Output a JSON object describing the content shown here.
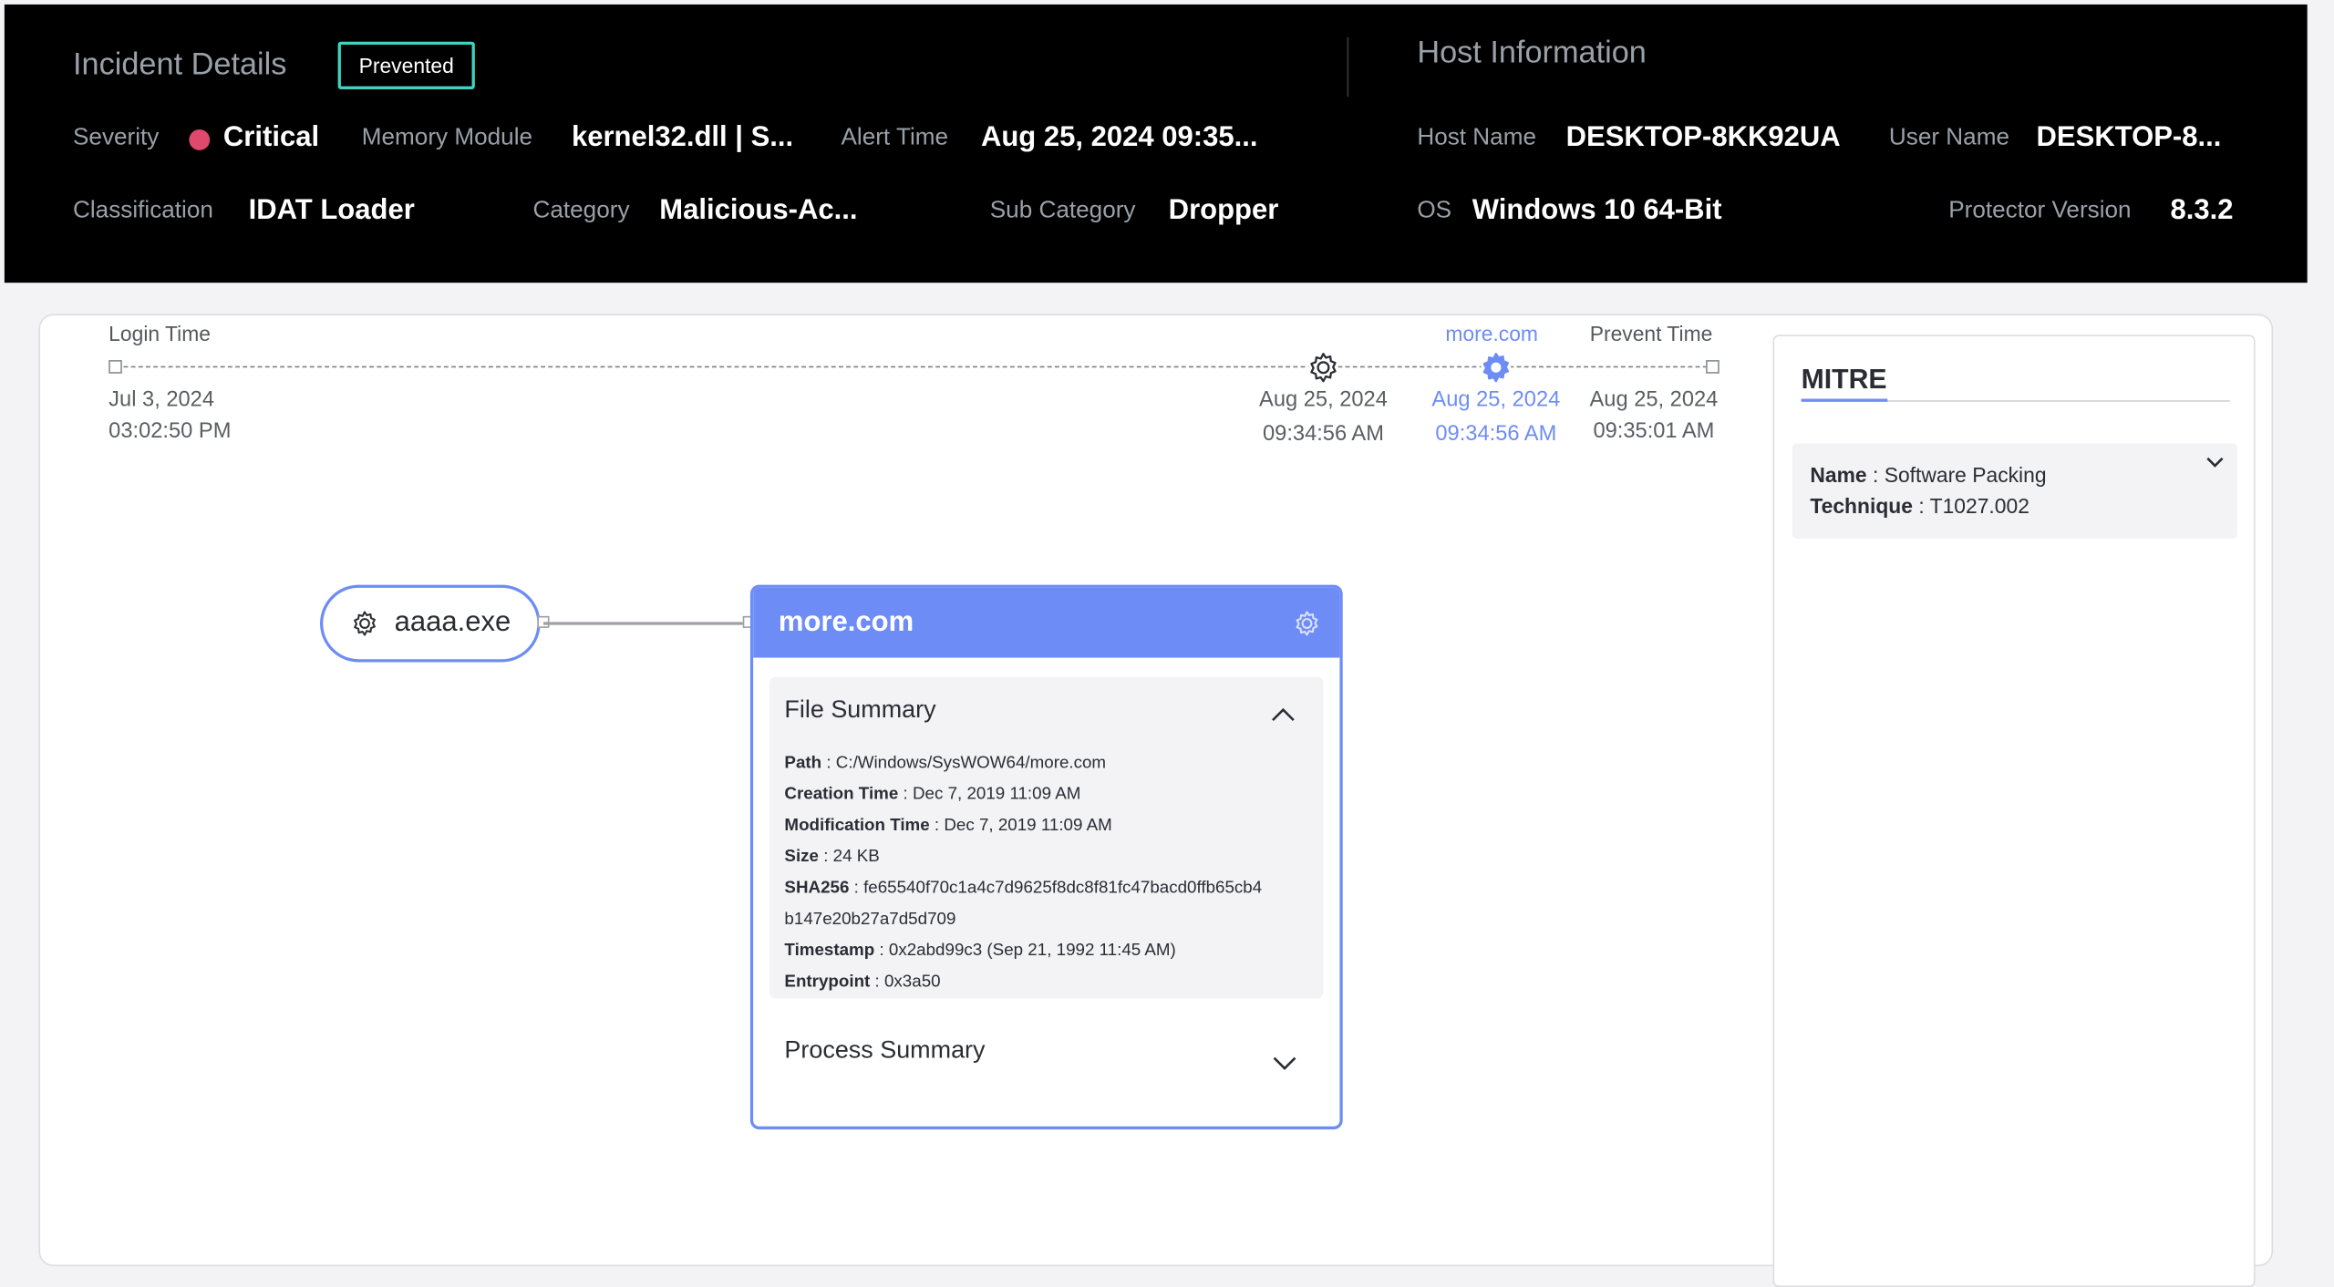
{
  "incident": {
    "title": "Incident Details",
    "status_badge": "Prevented",
    "severity_label": "Severity",
    "severity_value": "Critical",
    "memory_module_label": "Memory Module",
    "memory_module_value": "kernel32.dll | S...",
    "alert_time_label": "Alert Time",
    "alert_time_value": "Aug 25, 2024 09:35...",
    "classification_label": "Classification",
    "classification_value": "IDAT Loader",
    "category_label": "Category",
    "category_value": "Malicious-Ac...",
    "sub_category_label": "Sub Category",
    "sub_category_value": "Dropper"
  },
  "host": {
    "title": "Host Information",
    "host_name_label": "Host Name",
    "host_name_value": "DESKTOP-8KK92UA",
    "user_name_label": "User Name",
    "user_name_value": "DESKTOP-8...",
    "os_label": "OS",
    "os_value": "Windows 10 64-Bit",
    "protector_label": "Protector Version",
    "protector_value": "8.3.2"
  },
  "timeline": {
    "login_label": "Login Time",
    "login_date": "Jul 3, 2024",
    "login_time": "03:02:50 PM",
    "event1_date": "Aug 25, 2024",
    "event1_time": "09:34:56 AM",
    "event2_label": "more.com",
    "event2_date": "Aug 25, 2024",
    "event2_time": "09:34:56 AM",
    "prevent_label": "Prevent Time",
    "prevent_date": "Aug 25, 2024",
    "prevent_time": "09:35:01 AM"
  },
  "graph": {
    "parent_node": "aaaa.exe",
    "child_node": "more.com",
    "file_summary_title": "File Summary",
    "file_summary": [
      {
        "key": "Path",
        "sep": " : ",
        "value": "C:/Windows/SysWOW64/more.com"
      },
      {
        "key": "Creation Time",
        "sep": " : ",
        "value": "Dec 7, 2019 11:09 AM"
      },
      {
        "key": "Modification Time",
        "sep": " : ",
        "value": "Dec 7, 2019 11:09 AM"
      },
      {
        "key": "Size",
        "sep": " : ",
        "value": "24 KB"
      },
      {
        "key": "SHA256",
        "sep": " : ",
        "value": "fe65540f70c1a4c7d9625f8dc8f81fc47bacd0ffb65cb4"
      },
      {
        "key": "",
        "sep": "",
        "value": "b147e20b27a7d5d709"
      },
      {
        "key": "Timestamp",
        "sep": " : ",
        "value": "0x2abd99c3 (Sep 21, 1992 11:45 AM)"
      },
      {
        "key": "Entrypoint",
        "sep": " : ",
        "value": "0x3a50"
      }
    ],
    "process_summary_title": "Process Summary"
  },
  "mitre": {
    "title": "MITRE",
    "name_label": "Name",
    "name_value": "Software Packing",
    "technique_label": "Technique",
    "technique_value": "T1027.002",
    "sep": " : "
  },
  "colors": {
    "accent": "#6e8cf5",
    "critical": "#e0486c",
    "badge_border": "#3fd4c2",
    "header_bg": "#000000"
  },
  "icons": [
    "gear-icon",
    "chevron-up-icon",
    "chevron-down-icon"
  ]
}
